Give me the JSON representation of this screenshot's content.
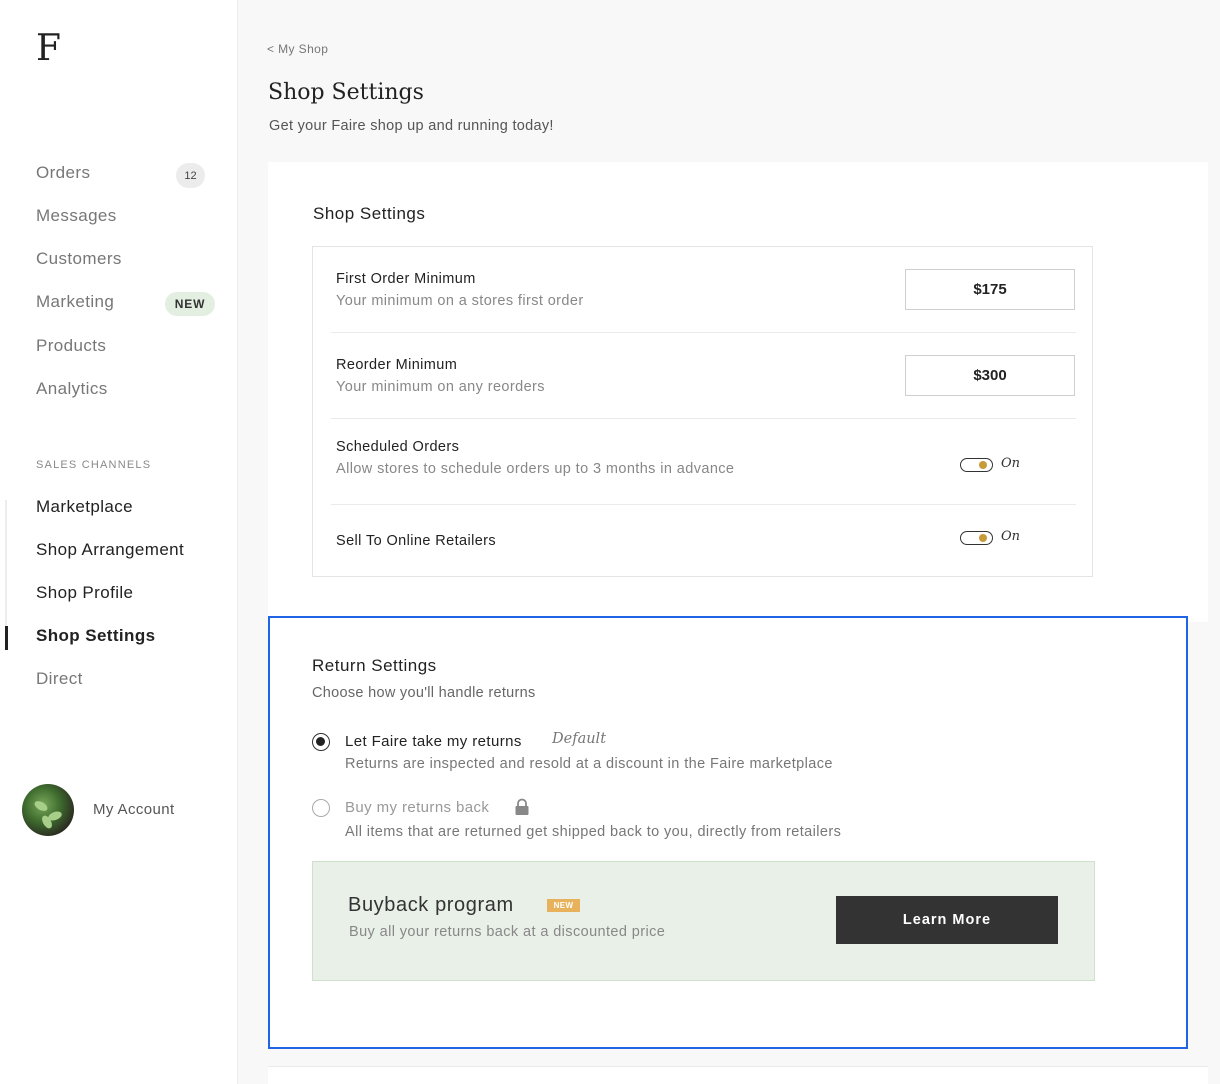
{
  "brand": {
    "logo": "F"
  },
  "sidebar": {
    "nav": [
      {
        "label": "Orders",
        "badge": "12"
      },
      {
        "label": "Messages"
      },
      {
        "label": "Customers"
      },
      {
        "label": "Marketing",
        "badge": "NEW"
      },
      {
        "label": "Products"
      },
      {
        "label": "Analytics"
      }
    ],
    "sales_channels_heading": "SALES CHANNELS",
    "channels": [
      {
        "label": "Marketplace"
      },
      {
        "label": "Shop Arrangement"
      },
      {
        "label": "Shop Profile"
      },
      {
        "label": "Shop Settings",
        "active": true
      },
      {
        "label": "Direct"
      }
    ],
    "account_label": "My Account"
  },
  "header": {
    "breadcrumb": "< My Shop",
    "title": "Shop Settings",
    "subtitle": "Get your Faire shop up and running today!"
  },
  "shop_settings": {
    "title": "Shop Settings",
    "first_order": {
      "label": "First Order Minimum",
      "description": "Your minimum on a stores first order",
      "value": "$175"
    },
    "reorder": {
      "label": "Reorder Minimum",
      "description": "Your minimum on any reorders",
      "value": "$300"
    },
    "scheduled": {
      "label": "Scheduled Orders",
      "description": "Allow stores to schedule orders up to 3 months in advance",
      "state": "On"
    },
    "online": {
      "label": "Sell To Online Retailers",
      "state": "On"
    }
  },
  "return_settings": {
    "title": "Return Settings",
    "subtitle": "Choose how you'll handle returns",
    "option_faire": {
      "label": "Let Faire take my returns",
      "tag": "Default",
      "description": "Returns are inspected and resold at a discount in the Faire marketplace",
      "selected": true
    },
    "option_buyback": {
      "label": "Buy my returns back",
      "description": "All items that are returned get shipped back to you, directly from retailers",
      "locked": true
    },
    "buyback_program": {
      "title": "Buyback program",
      "badge": "NEW",
      "description": "Buy all your returns back at a discounted price",
      "button": "Learn More"
    }
  },
  "colors": {
    "focus_outline": "#1f63e6",
    "toggle_knob": "#c79a3a",
    "new_badge_bg": "#e3efe1",
    "buyback_bg": "#e9f0e8",
    "buyback_badge": "#e7b25b"
  }
}
